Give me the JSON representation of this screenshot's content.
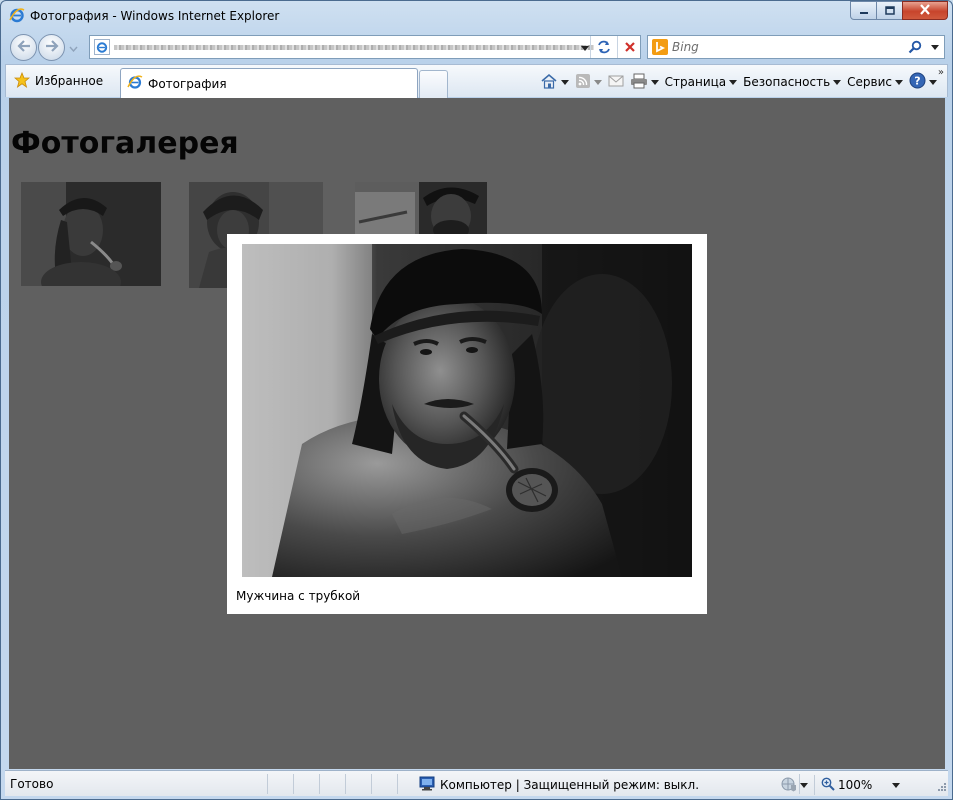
{
  "window": {
    "title": "Фотография - Windows Internet Explorer",
    "minimize_icon": "minimize-icon",
    "maximize_icon": "maximize-icon",
    "close_icon": "close-icon"
  },
  "nav": {
    "back_icon": "back-arrow-icon",
    "forward_icon": "forward-arrow-icon",
    "address_url": "",
    "search_placeholder": "Bing"
  },
  "command_bar": {
    "favorites_label": "Избранное",
    "tab_label": "Фотография",
    "page_menu": "Страница",
    "safety_menu": "Безопасность",
    "tools_menu": "Сервис"
  },
  "page": {
    "heading": "Фотогалерея",
    "thumbnails": [
      {
        "alt": "thumbnail-1"
      },
      {
        "alt": "thumbnail-2"
      },
      {
        "alt": "thumbnail-3"
      }
    ],
    "lightbox": {
      "caption": "Мужчина с трубкой"
    }
  },
  "status_bar": {
    "status_text": "Готово",
    "zone_text": "Компьютер | Защищенный режим: выкл.",
    "zoom_level": "100%"
  },
  "colors": {
    "overlay": "#606060",
    "frame": "#b9d1ea",
    "close_button": "#c7442c"
  }
}
